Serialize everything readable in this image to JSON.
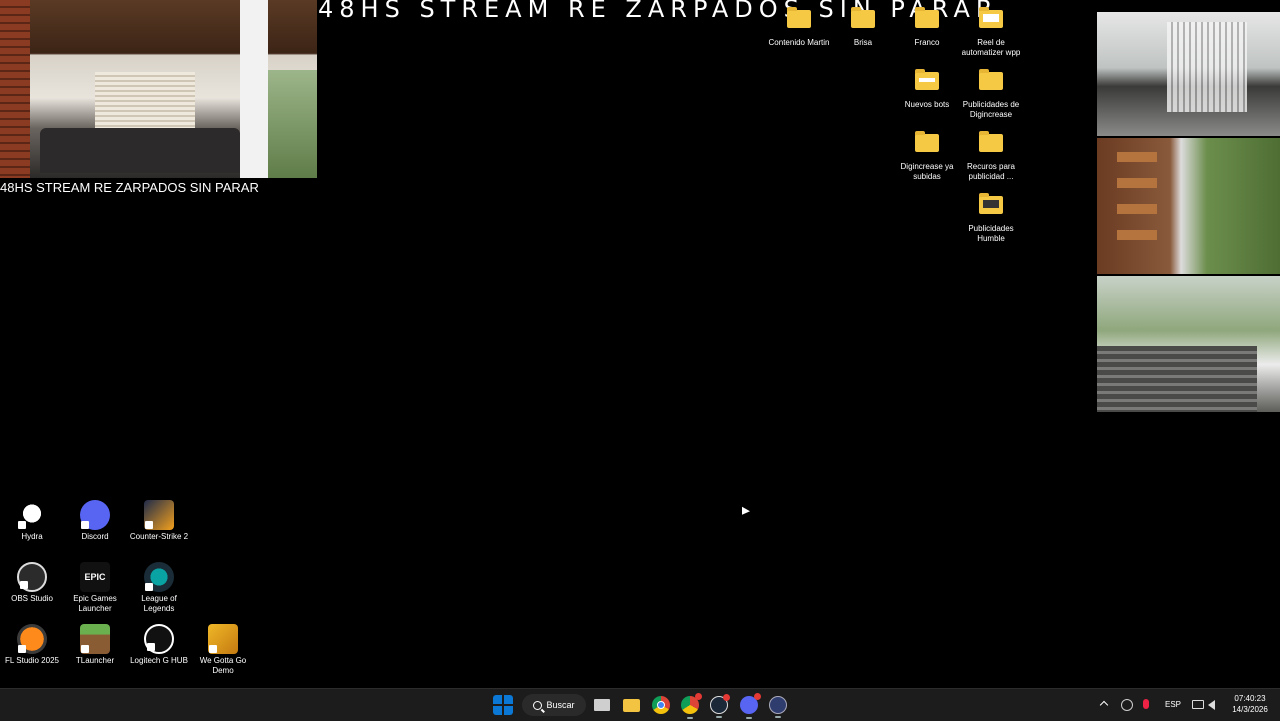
{
  "banner": {
    "title": "48HS STREAM RE ZARPADOS SIN PARAR"
  },
  "stream": {
    "title": "48HS STREAM RE ZARPADOS SIN PARAR"
  },
  "desktop_icons_right": [
    {
      "label": "Contenido Martin",
      "icon": "folder-icon"
    },
    {
      "label": "Brisa",
      "icon": "folder-icon"
    },
    {
      "label": "Franco",
      "icon": "folder-icon"
    },
    {
      "label": "Reel de automatizer wpp",
      "icon": "folder-icon"
    },
    {
      "label": "Nuevos bots",
      "icon": "folder-icon"
    },
    {
      "label": "Publicidades de Digincrease",
      "icon": "folder-icon"
    },
    {
      "label": "Digincrease ya subidas",
      "icon": "folder-icon"
    },
    {
      "label": "Recuros para publicidad ...",
      "icon": "folder-icon"
    },
    {
      "label": "Publicidades Humble",
      "icon": "folder-icon"
    }
  ],
  "desktop_icons_left": [
    {
      "label": "Hydra",
      "icon": "hydra-icon"
    },
    {
      "label": "Discord",
      "icon": "discord-icon"
    },
    {
      "label": "Counter-Strike 2",
      "icon": "counter-strike-icon"
    },
    {
      "label": "OBS Studio",
      "icon": "obs-icon"
    },
    {
      "label": "Epic Games Launcher",
      "icon": "epic-games-icon",
      "glyph": "EPIC"
    },
    {
      "label": "League of Legends",
      "icon": "league-of-legends-icon"
    },
    {
      "label": "FL Studio 2025",
      "icon": "fl-studio-icon"
    },
    {
      "label": "TLauncher",
      "icon": "tlauncher-icon"
    },
    {
      "label": "Logitech G HUB",
      "icon": "logitech-icon"
    },
    {
      "label": "We Gotta Go Demo",
      "icon": "we-gotta-go-icon"
    }
  ],
  "taskbar": {
    "search_label": "Buscar",
    "apps": [
      "windows-start",
      "task-view",
      "file-explorer",
      "chrome",
      "chrome-profile",
      "steam",
      "discord",
      "obs"
    ]
  },
  "tray": {
    "language": "ESP",
    "time": "07:40:23",
    "date": "14/3/2026"
  }
}
